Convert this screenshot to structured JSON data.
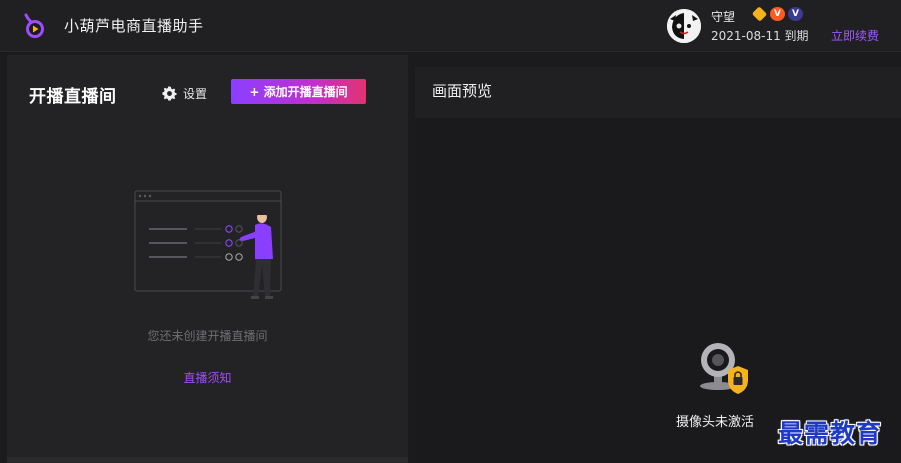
{
  "app": {
    "title": "小葫芦电商直播助手"
  },
  "user": {
    "name": "守望",
    "badges": [
      {
        "icon": "diamond-badge-icon",
        "color": "#f5b21a"
      },
      {
        "icon": "v-badge-icon",
        "text": "V",
        "color": "#ff5a1f"
      },
      {
        "icon": "v-badge-icon",
        "text": "V",
        "color": "#3b3b8f"
      }
    ],
    "expire_text": "2021-08-11 到期",
    "renew_label": "立即续费"
  },
  "left_panel": {
    "title": "开播直播间",
    "settings_label": "设置",
    "add_button_label": "+ 添加开播直播间",
    "empty_text": "您还未创建开播直播间",
    "notice_link": "直播须知"
  },
  "right_panel": {
    "title": "画面预览",
    "camera_status": "摄像头未激活"
  },
  "watermark": "最需教育",
  "colors": {
    "accent_purple": "#a04df5",
    "button_gradient_start": "#8a3fff",
    "button_gradient_end": "#e2336f"
  }
}
